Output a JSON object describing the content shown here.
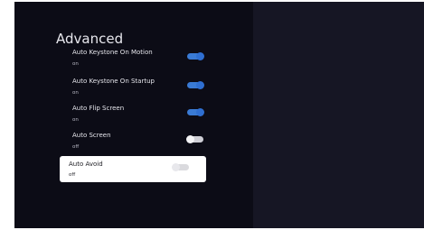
{
  "screen": {
    "title": "Advanced",
    "settings": [
      {
        "label": "Auto Keystone On Motion",
        "value": "on",
        "enabled": true
      },
      {
        "label": "Auto Keystone On Startup",
        "value": "on",
        "enabled": true
      },
      {
        "label": "Auto Flip Screen",
        "value": "on",
        "enabled": true
      },
      {
        "label": "Auto Screen",
        "value": "off",
        "enabled": false
      },
      {
        "label": "Auto Avoid",
        "value": "off",
        "enabled": false,
        "focused": true
      }
    ]
  },
  "colors": {
    "background": "#0c0c16",
    "accent": "#3a7bd5",
    "focus": "#ffffff"
  }
}
